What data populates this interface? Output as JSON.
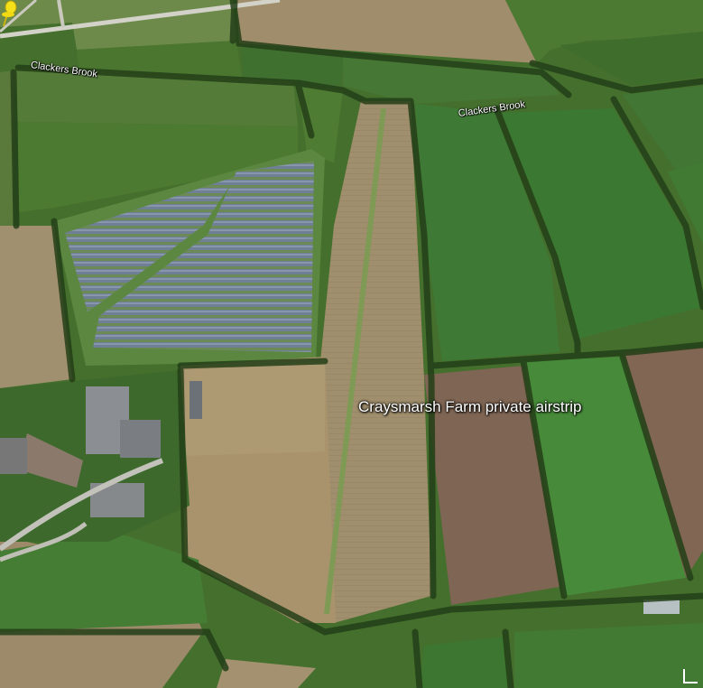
{
  "map": {
    "view": "satellite",
    "labels": {
      "brook_west": "Clackers Brook",
      "brook_east": "Clackers Brook"
    },
    "placemark": {
      "label": "Craysmarsh Farm private airstrip",
      "icon": "yellow-pushpin-icon",
      "color": "#f5e11a"
    }
  }
}
